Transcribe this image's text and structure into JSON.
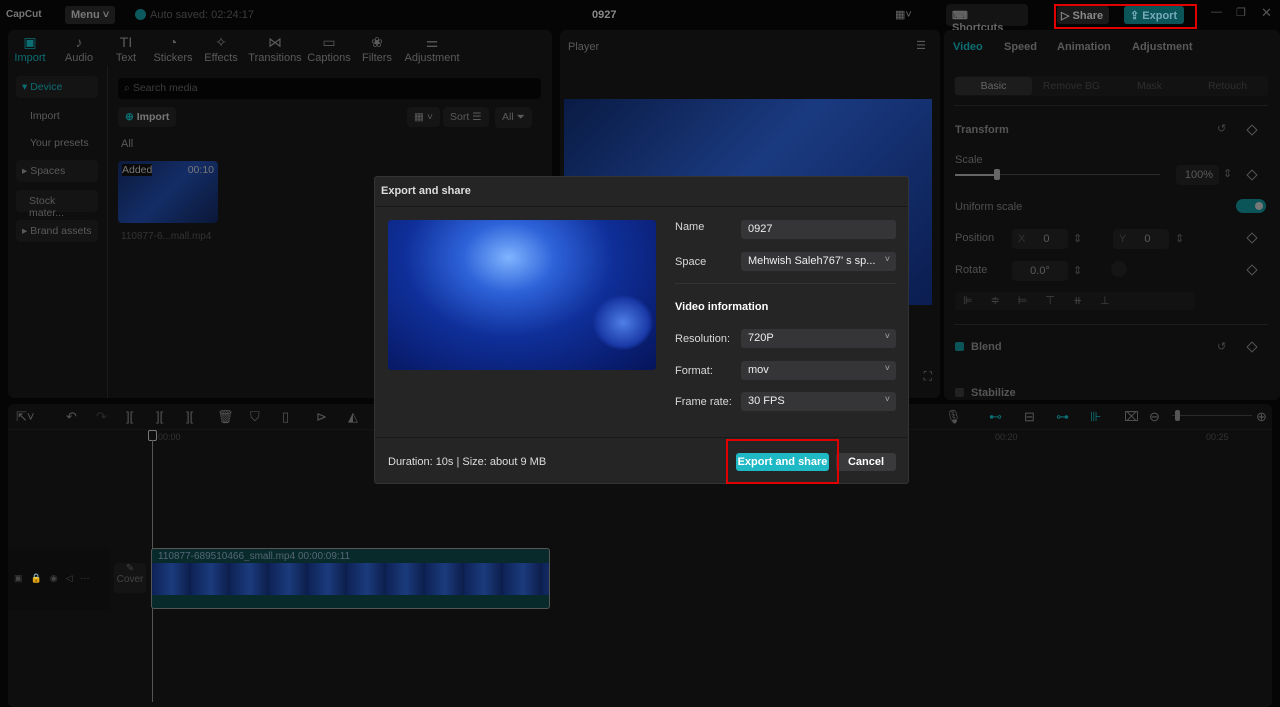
{
  "app": {
    "logo": "CapCut",
    "menu": "Menu",
    "autosave": "Auto saved: 02:24:17",
    "project_title": "0927",
    "shortcuts": "Shortcuts",
    "share": "Share",
    "export": "Export"
  },
  "toolbar": [
    {
      "label": "Import",
      "icon": "import-icon"
    },
    {
      "label": "Audio",
      "icon": "audio-icon"
    },
    {
      "label": "Text",
      "icon": "text-icon"
    },
    {
      "label": "Stickers",
      "icon": "stickers-icon"
    },
    {
      "label": "Effects",
      "icon": "effects-icon"
    },
    {
      "label": "Transitions",
      "icon": "transitions-icon"
    },
    {
      "label": "Captions",
      "icon": "captions-icon"
    },
    {
      "label": "Filters",
      "icon": "filters-icon"
    },
    {
      "label": "Adjustment",
      "icon": "adjustment-icon"
    }
  ],
  "sidebar": {
    "device": "Device",
    "import": "Import",
    "presets": "Your presets",
    "spaces": "Spaces",
    "stock": "Stock mater...",
    "brand": "Brand assets"
  },
  "media": {
    "search_placeholder": "Search media",
    "import_btn": "Import",
    "sort": "Sort",
    "all_filter": "All",
    "section": "All",
    "item": {
      "badge": "Added",
      "duration": "00:10",
      "name": "110877-6...mall.mp4"
    }
  },
  "player": {
    "title": "Player"
  },
  "right": {
    "tabs": [
      "Video",
      "Speed",
      "Animation",
      "Adjustment"
    ],
    "subtabs": [
      "Basic",
      "Remove BG",
      "Mask",
      "Retouch"
    ],
    "transform": "Transform",
    "scale": "Scale",
    "scale_value": "100%",
    "scale_fraction": 0.2,
    "uniform": "Uniform scale",
    "uniform_on": true,
    "position": "Position",
    "x_label": "X",
    "x": "0",
    "y_label": "Y",
    "y": "0",
    "rotate": "Rotate",
    "rotate_value": "0.0°",
    "blend": "Blend",
    "stabilize": "Stabilize"
  },
  "timeline": {
    "ticks": [
      "00:00",
      "00:20",
      "00:25"
    ],
    "clip_name": "110877-689510466_small.mp4",
    "clip_duration": "00:00:09:11",
    "cover": "Cover"
  },
  "dialog": {
    "title": "Export and share",
    "name_label": "Name",
    "name_value": "0927",
    "space_label": "Space",
    "space_value": "Mehwish Saleh767'  s sp...",
    "video_info": "Video information",
    "resolution_label": "Resolution:",
    "resolution": "720P",
    "format_label": "Format:",
    "format": "mov",
    "framerate_label": "Frame rate:",
    "framerate": "30 FPS",
    "summary": "Duration: 10s | Size: about 9 MB",
    "export_btn": "Export and share",
    "cancel_btn": "Cancel"
  },
  "colors": {
    "accent": "#1fb9c6",
    "highlight": "#e00000"
  }
}
